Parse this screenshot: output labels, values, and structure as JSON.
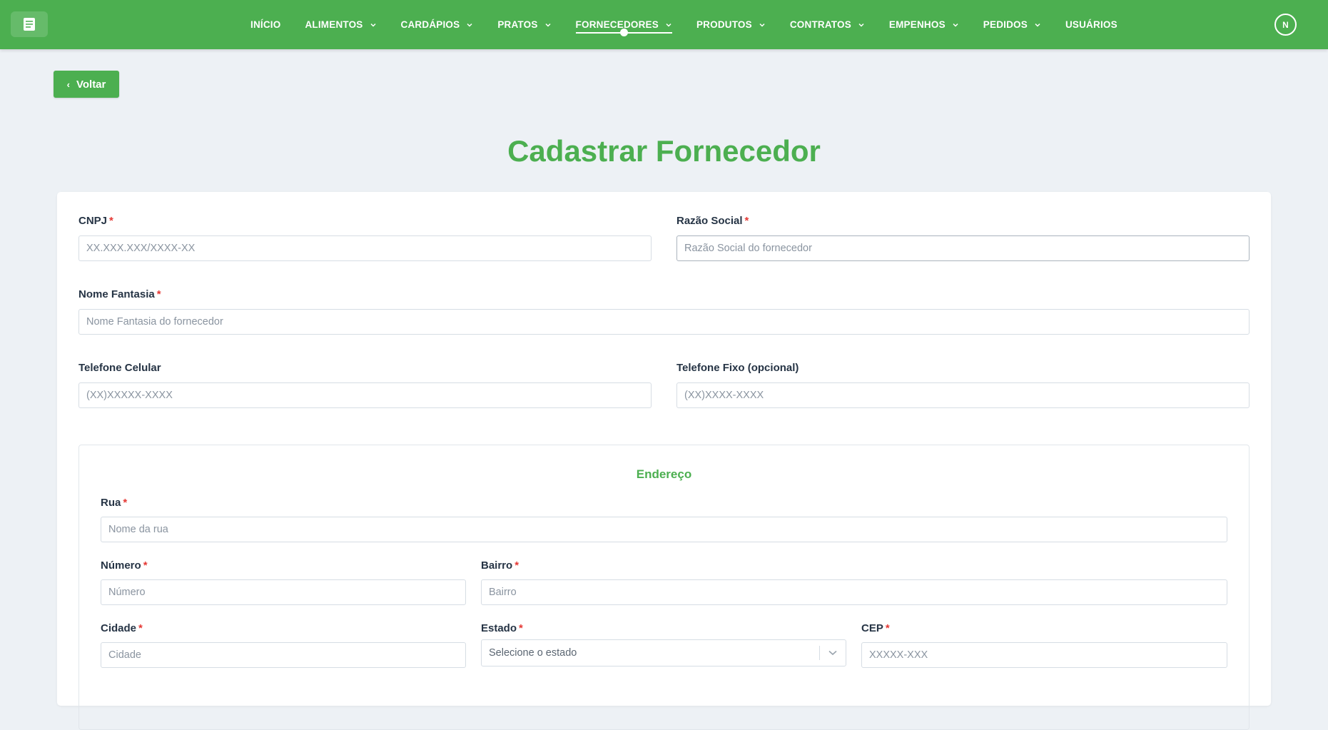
{
  "nav": {
    "items": [
      {
        "label": "INÍCIO",
        "has_dropdown": false,
        "active": false
      },
      {
        "label": "ALIMENTOS",
        "has_dropdown": true,
        "active": false
      },
      {
        "label": "CARDÁPIOS",
        "has_dropdown": true,
        "active": false
      },
      {
        "label": "PRATOS",
        "has_dropdown": true,
        "active": false
      },
      {
        "label": "FORNECEDORES",
        "has_dropdown": true,
        "active": true
      },
      {
        "label": "PRODUTOS",
        "has_dropdown": true,
        "active": false
      },
      {
        "label": "CONTRATOS",
        "has_dropdown": true,
        "active": false
      },
      {
        "label": "EMPENHOS",
        "has_dropdown": true,
        "active": false
      },
      {
        "label": "PEDIDOS",
        "has_dropdown": true,
        "active": false
      },
      {
        "label": "USUÁRIOS",
        "has_dropdown": false,
        "active": false
      }
    ],
    "avatar_initial": "N",
    "logo_icon": "book-icon"
  },
  "back_button": {
    "label": "Voltar"
  },
  "page_title": "Cadastrar Fornecedor",
  "form": {
    "cnpj": {
      "label": "CNPJ",
      "required": "*",
      "placeholder": "XX.XXX.XXX/XXXX-XX"
    },
    "razao_social": {
      "label": "Razão Social",
      "required": "*",
      "placeholder": "Razão Social do fornecedor"
    },
    "nome_fantasia": {
      "label": "Nome Fantasia",
      "required": "*",
      "placeholder": "Nome Fantasia do fornecedor"
    },
    "telefone_celular": {
      "label": "Telefone Celular",
      "placeholder": "(XX)XXXXX-XXXX"
    },
    "telefone_fixo": {
      "label": "Telefone Fixo (opcional)",
      "placeholder": "(XX)XXXX-XXXX"
    }
  },
  "address": {
    "title": "Endereço",
    "rua": {
      "label": "Rua",
      "required": "*",
      "placeholder": "Nome da rua"
    },
    "numero": {
      "label": "Número",
      "required": "*",
      "placeholder": "Número"
    },
    "bairro": {
      "label": "Bairro",
      "required": "*",
      "placeholder": "Bairro"
    },
    "cidade": {
      "label": "Cidade",
      "required": "*",
      "placeholder": "Cidade"
    },
    "estado": {
      "label": "Estado",
      "required": "*",
      "selected": "Selecione o estado"
    },
    "cep": {
      "label": "CEP",
      "required": "*",
      "placeholder": "XXXXX-XXX"
    }
  },
  "colors": {
    "primary": "#4caf50",
    "background": "#edf1f5",
    "required": "#e53935"
  }
}
